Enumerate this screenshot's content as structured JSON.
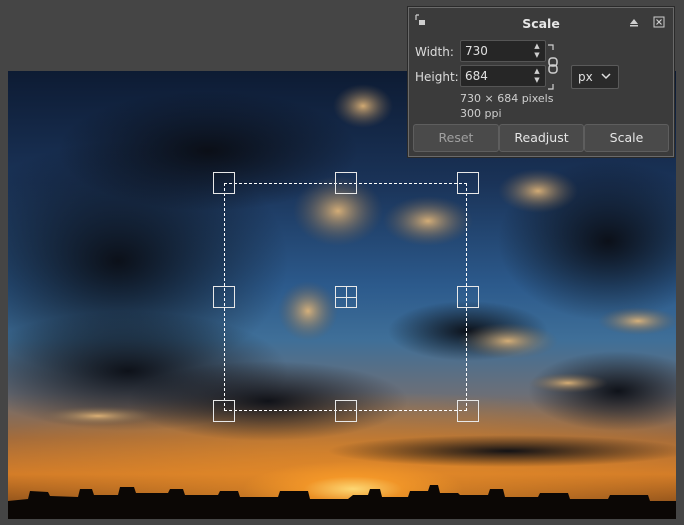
{
  "dialog": {
    "title": "Scale",
    "width_label": "Width:",
    "width_value": "730",
    "height_label": "Height:",
    "height_value": "684",
    "unit": "px",
    "size_info": "730 × 684 pixels",
    "resolution_info": "300 ppi",
    "buttons": {
      "reset": "Reset",
      "readjust": "Readjust",
      "scale": "Scale"
    },
    "icons": {
      "dock": "dock-icon",
      "detach": "detach-icon",
      "close": "close-icon",
      "chain": "chain-link-icon",
      "unit_dropdown": "chevron-down-icon"
    }
  },
  "canvas": {
    "image": "sunset-sky-photo",
    "colors": {
      "handle": "#e8e8e8",
      "selection": "#ffffff"
    }
  }
}
